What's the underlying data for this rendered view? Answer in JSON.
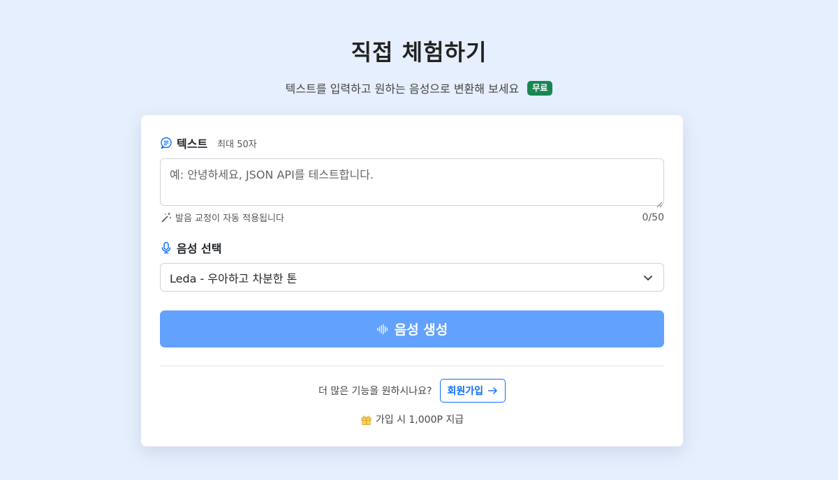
{
  "header": {
    "title": "직접 체험하기",
    "subtitle": "텍스트를 입력하고 원하는 음성으로 변환해 보세요",
    "badge": "무료"
  },
  "text_section": {
    "label": "텍스트",
    "hint": "최대 50자",
    "icon": "chat-bubble-icon",
    "placeholder": "예: 안녕하세요, JSON API를 테스트합니다.",
    "value": "",
    "correction_note": "발음 교정이 자동 적용됩니다",
    "correction_icon": "magic-wand-icon",
    "counter": "0/50"
  },
  "voice_section": {
    "label": "음성 선택",
    "icon": "microphone-icon",
    "selected": "Leda - 우아하고 차분한 톤"
  },
  "generate_button": {
    "label": "음성 생성",
    "icon": "soundwave-icon"
  },
  "cta": {
    "question": "더 많은 기능을 원하시나요?",
    "signup_label": "회원가입",
    "bonus": "가입 시 1,000P 지급",
    "bonus_icon": "gift-icon"
  },
  "colors": {
    "background": "#e6effd",
    "primary": "#0d6efd",
    "button": "#62a1fd",
    "badge": "#198754"
  }
}
